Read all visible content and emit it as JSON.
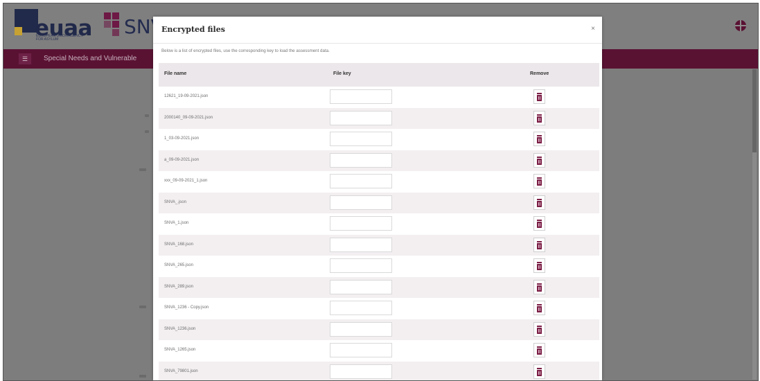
{
  "header": {
    "euaa_logo_text": "euaa",
    "euaa_logo_subtext": "EUROPEAN UNION AGENCY FOR ASYLUM",
    "snva_logo_text": "SNVA",
    "language_icon": "globe-icon"
  },
  "navbar": {
    "menu_icon": "menu-icon",
    "title": "Special Needs and Vulnerable"
  },
  "modal": {
    "title": "Encrypted files",
    "close_icon": "close-icon",
    "close_glyph": "×",
    "description": "Below is a list of encrypted files, use the corresponding key to load the assessment data.",
    "columns": {
      "file_name": "File name",
      "file_key": "File key",
      "remove": "Remove"
    },
    "rows": [
      {
        "file_name": "12621_19-09-2021.json",
        "file_key": ""
      },
      {
        "file_name": "2000140_09-09-2021.json",
        "file_key": ""
      },
      {
        "file_name": "1_03-09-2021.json",
        "file_key": ""
      },
      {
        "file_name": "a_09-09-2021.json",
        "file_key": ""
      },
      {
        "file_name": "xxx_09-09-2021_1.json",
        "file_key": ""
      },
      {
        "file_name": "SNVA_.json",
        "file_key": ""
      },
      {
        "file_name": "SNVA_1.json",
        "file_key": ""
      },
      {
        "file_name": "SNVA_168.json",
        "file_key": ""
      },
      {
        "file_name": "SNVA_265.json",
        "file_key": ""
      },
      {
        "file_name": "SNVA_289.json",
        "file_key": ""
      },
      {
        "file_name": "SNVA_1236 - Copy.json",
        "file_key": ""
      },
      {
        "file_name": "SNVA_1236.json",
        "file_key": ""
      },
      {
        "file_name": "SNVA_1265.json",
        "file_key": ""
      },
      {
        "file_name": "SNVA_79801.json",
        "file_key": ""
      }
    ],
    "remove_icon": "trash-icon"
  },
  "colors": {
    "brand_maroon": "#5a1233",
    "overlay_gray": "#7d7d7d",
    "trash_red": "#7b1d45",
    "header_row": "#ece7ea"
  }
}
